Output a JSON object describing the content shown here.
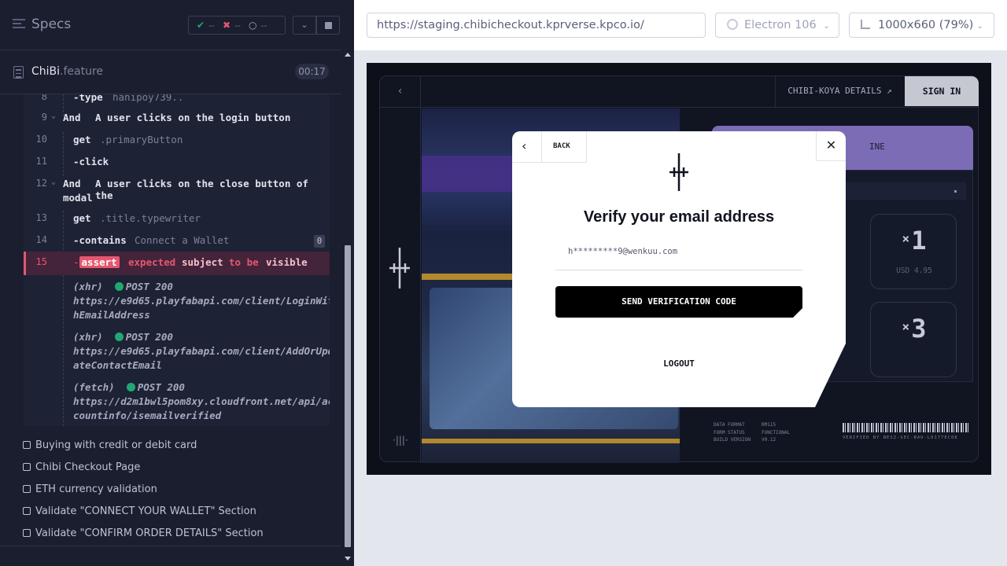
{
  "specs_header": {
    "title": "Specs",
    "passed": "--",
    "failed": "--",
    "pending": "--"
  },
  "file": {
    "name": "ChiBi",
    "ext": ".feature",
    "duration": "00:17"
  },
  "command_log": {
    "lines": [
      {
        "num": "8",
        "prefix": "-",
        "cmd": "type",
        "arg": "hanipoy739.."
      },
      {
        "num": "9",
        "keyword": "And",
        "text": "A user clicks on the login button"
      },
      {
        "num": "10",
        "cmd": "get",
        "arg": ".primaryButton"
      },
      {
        "num": "11",
        "prefix": "-",
        "cmd": "click"
      },
      {
        "num": "12",
        "keyword": "And",
        "text_line1": "A user clicks on the close button of the",
        "text_line2": "modal"
      },
      {
        "num": "13",
        "cmd": "get",
        "arg": ".title.typewriter"
      },
      {
        "num": "14",
        "prefix": "-",
        "cmd": "contains",
        "arg": "Connect a Wallet",
        "count": "0"
      },
      {
        "num": "15",
        "prefix": "-",
        "cmd": "assert",
        "w1": "expected",
        "w2": "subject",
        "w3": "to be",
        "w4": "visible"
      }
    ],
    "requests": [
      {
        "type": "(xhr)",
        "method": "POST 200",
        "url1": "https://e9d65.playfabapi.com/client/LoginWit",
        "url2": "hEmailAddress"
      },
      {
        "type": "(xhr)",
        "method": "POST 200",
        "url1": "https://e9d65.playfabapi.com/client/AddOrUpd",
        "url2": "ateContactEmail"
      },
      {
        "type": "(fetch)",
        "method": "POST 200",
        "url1": "https://d2m1bwl5pom8xy.cloudfront.net/api/ac",
        "url2": "countinfo/isemailverified"
      }
    ]
  },
  "spec_list": [
    "Buying with credit or debit card",
    "Chibi Checkout Page",
    "ETH currency validation",
    "Validate \"CONNECT YOUR WALLET\" Section",
    "Validate \"CONFIRM ORDER DETAILS\" Section"
  ],
  "aut_bar": {
    "url": "https://staging.chibicheckout.kprverse.kpco.io/",
    "browser": "Electron 106",
    "viewport": "1000x660 (79%)"
  },
  "app": {
    "details_link": "CHIBI-KOYA DETAILS ↗",
    "signin": "SIGN IN",
    "card_label": "INE",
    "qty1": "1",
    "qty1_price": "USD 4.95",
    "qty2": "3",
    "meta_labels": [
      "DATA FORMAT",
      "FORM STATUS",
      "BUILD VERSION"
    ],
    "meta_values": [
      "RM115",
      "FUNCTIONAL",
      "V0.12"
    ],
    "verified": "VERIFIED BY NESZ-SEC-BAU-L0177EC08"
  },
  "modal": {
    "back": "BACK",
    "title": "Verify your email address",
    "email": "h*********9@wenkuu.com",
    "send_button": "SEND VERIFICATION CODE",
    "logout": "LOGOUT"
  },
  "colors": {
    "pass": "#1fa971",
    "fail": "#e45770",
    "accent_purple": "#7c6cb6"
  }
}
